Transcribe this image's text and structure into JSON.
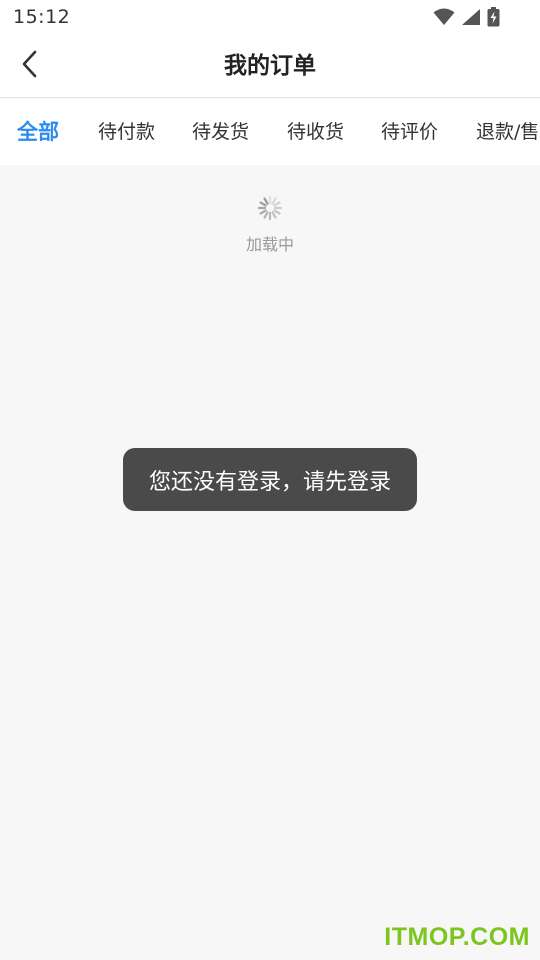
{
  "status_bar": {
    "time": "15:12",
    "icons": [
      "wifi-icon",
      "cellular-signal-icon",
      "battery-charging-icon"
    ]
  },
  "header": {
    "back_icon": "chevron-left-icon",
    "title": "我的订单"
  },
  "tabs": {
    "active_color": "#2d8cf0",
    "items": [
      {
        "label": "全部",
        "active": true
      },
      {
        "label": "待付款",
        "active": false
      },
      {
        "label": "待发货",
        "active": false
      },
      {
        "label": "待收货",
        "active": false
      },
      {
        "label": "待评价",
        "active": false
      },
      {
        "label": "退款/售后",
        "active": false
      }
    ]
  },
  "content": {
    "loading_icon": "spinner-icon",
    "loading_text": "加载中"
  },
  "toast": {
    "message": "您还没有登录，请先登录"
  },
  "watermark": {
    "text": "ITMOP.COM",
    "color": "#7dc51f"
  }
}
